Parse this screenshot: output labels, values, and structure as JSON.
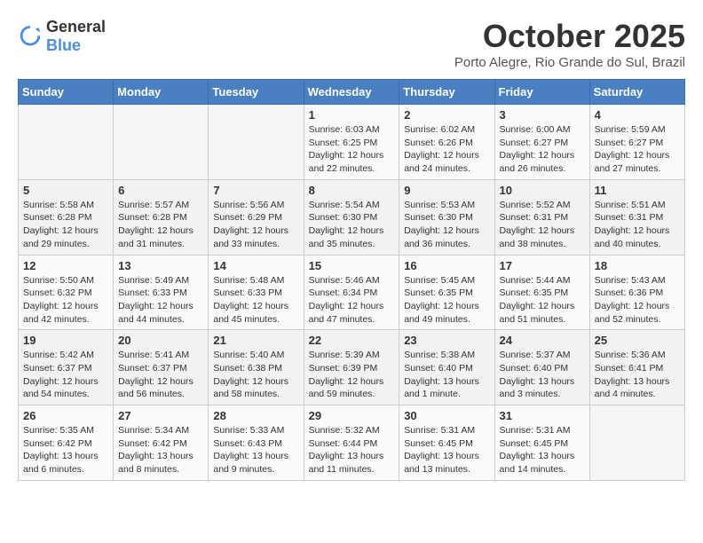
{
  "header": {
    "logo_general": "General",
    "logo_blue": "Blue",
    "month_title": "October 2025",
    "location": "Porto Alegre, Rio Grande do Sul, Brazil"
  },
  "weekdays": [
    "Sunday",
    "Monday",
    "Tuesday",
    "Wednesday",
    "Thursday",
    "Friday",
    "Saturday"
  ],
  "weeks": [
    [
      {
        "day": "",
        "info": ""
      },
      {
        "day": "",
        "info": ""
      },
      {
        "day": "",
        "info": ""
      },
      {
        "day": "1",
        "info": "Sunrise: 6:03 AM\nSunset: 6:25 PM\nDaylight: 12 hours\nand 22 minutes."
      },
      {
        "day": "2",
        "info": "Sunrise: 6:02 AM\nSunset: 6:26 PM\nDaylight: 12 hours\nand 24 minutes."
      },
      {
        "day": "3",
        "info": "Sunrise: 6:00 AM\nSunset: 6:27 PM\nDaylight: 12 hours\nand 26 minutes."
      },
      {
        "day": "4",
        "info": "Sunrise: 5:59 AM\nSunset: 6:27 PM\nDaylight: 12 hours\nand 27 minutes."
      }
    ],
    [
      {
        "day": "5",
        "info": "Sunrise: 5:58 AM\nSunset: 6:28 PM\nDaylight: 12 hours\nand 29 minutes."
      },
      {
        "day": "6",
        "info": "Sunrise: 5:57 AM\nSunset: 6:28 PM\nDaylight: 12 hours\nand 31 minutes."
      },
      {
        "day": "7",
        "info": "Sunrise: 5:56 AM\nSunset: 6:29 PM\nDaylight: 12 hours\nand 33 minutes."
      },
      {
        "day": "8",
        "info": "Sunrise: 5:54 AM\nSunset: 6:30 PM\nDaylight: 12 hours\nand 35 minutes."
      },
      {
        "day": "9",
        "info": "Sunrise: 5:53 AM\nSunset: 6:30 PM\nDaylight: 12 hours\nand 36 minutes."
      },
      {
        "day": "10",
        "info": "Sunrise: 5:52 AM\nSunset: 6:31 PM\nDaylight: 12 hours\nand 38 minutes."
      },
      {
        "day": "11",
        "info": "Sunrise: 5:51 AM\nSunset: 6:31 PM\nDaylight: 12 hours\nand 40 minutes."
      }
    ],
    [
      {
        "day": "12",
        "info": "Sunrise: 5:50 AM\nSunset: 6:32 PM\nDaylight: 12 hours\nand 42 minutes."
      },
      {
        "day": "13",
        "info": "Sunrise: 5:49 AM\nSunset: 6:33 PM\nDaylight: 12 hours\nand 44 minutes."
      },
      {
        "day": "14",
        "info": "Sunrise: 5:48 AM\nSunset: 6:33 PM\nDaylight: 12 hours\nand 45 minutes."
      },
      {
        "day": "15",
        "info": "Sunrise: 5:46 AM\nSunset: 6:34 PM\nDaylight: 12 hours\nand 47 minutes."
      },
      {
        "day": "16",
        "info": "Sunrise: 5:45 AM\nSunset: 6:35 PM\nDaylight: 12 hours\nand 49 minutes."
      },
      {
        "day": "17",
        "info": "Sunrise: 5:44 AM\nSunset: 6:35 PM\nDaylight: 12 hours\nand 51 minutes."
      },
      {
        "day": "18",
        "info": "Sunrise: 5:43 AM\nSunset: 6:36 PM\nDaylight: 12 hours\nand 52 minutes."
      }
    ],
    [
      {
        "day": "19",
        "info": "Sunrise: 5:42 AM\nSunset: 6:37 PM\nDaylight: 12 hours\nand 54 minutes."
      },
      {
        "day": "20",
        "info": "Sunrise: 5:41 AM\nSunset: 6:37 PM\nDaylight: 12 hours\nand 56 minutes."
      },
      {
        "day": "21",
        "info": "Sunrise: 5:40 AM\nSunset: 6:38 PM\nDaylight: 12 hours\nand 58 minutes."
      },
      {
        "day": "22",
        "info": "Sunrise: 5:39 AM\nSunset: 6:39 PM\nDaylight: 12 hours\nand 59 minutes."
      },
      {
        "day": "23",
        "info": "Sunrise: 5:38 AM\nSunset: 6:40 PM\nDaylight: 13 hours\nand 1 minute."
      },
      {
        "day": "24",
        "info": "Sunrise: 5:37 AM\nSunset: 6:40 PM\nDaylight: 13 hours\nand 3 minutes."
      },
      {
        "day": "25",
        "info": "Sunrise: 5:36 AM\nSunset: 6:41 PM\nDaylight: 13 hours\nand 4 minutes."
      }
    ],
    [
      {
        "day": "26",
        "info": "Sunrise: 5:35 AM\nSunset: 6:42 PM\nDaylight: 13 hours\nand 6 minutes."
      },
      {
        "day": "27",
        "info": "Sunrise: 5:34 AM\nSunset: 6:42 PM\nDaylight: 13 hours\nand 8 minutes."
      },
      {
        "day": "28",
        "info": "Sunrise: 5:33 AM\nSunset: 6:43 PM\nDaylight: 13 hours\nand 9 minutes."
      },
      {
        "day": "29",
        "info": "Sunrise: 5:32 AM\nSunset: 6:44 PM\nDaylight: 13 hours\nand 11 minutes."
      },
      {
        "day": "30",
        "info": "Sunrise: 5:31 AM\nSunset: 6:45 PM\nDaylight: 13 hours\nand 13 minutes."
      },
      {
        "day": "31",
        "info": "Sunrise: 5:31 AM\nSunset: 6:45 PM\nDaylight: 13 hours\nand 14 minutes."
      },
      {
        "day": "",
        "info": ""
      }
    ]
  ]
}
